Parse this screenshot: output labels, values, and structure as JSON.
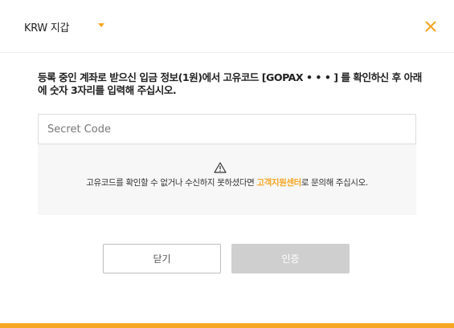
{
  "header": {
    "wallet_label": "KRW 지갑",
    "close_icon": "close-icon",
    "accent_color": "#f5a623"
  },
  "main": {
    "instruction": "등록 중인 계좌로 받으신 입금 정보(1원)에서 고유코드 [GOPAX • • • ] 를 확인하신 후 아래에 숫자 3자리를 입력해 주십시오.",
    "code_input": {
      "placeholder": "Secret Code",
      "value": ""
    },
    "notice": {
      "icon": "warning-icon",
      "text_before": "고유코드를 확인할 수 없거나 수신하지 못하셨다면 ",
      "link": "고객지원센터",
      "text_after": "로 문의해 주십시오."
    }
  },
  "footer": {
    "close_button": "닫기",
    "auth_button": "인증"
  }
}
